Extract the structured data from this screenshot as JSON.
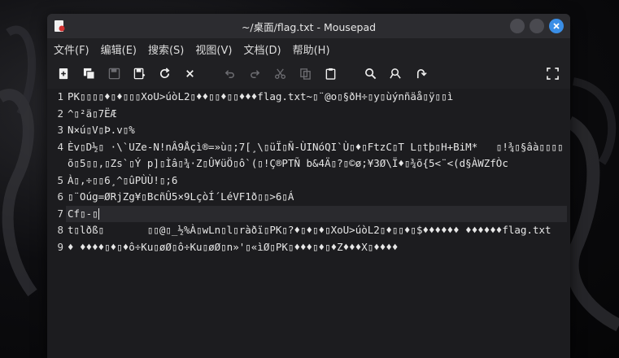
{
  "window": {
    "title": "~/桌面/flag.txt - Mousepad",
    "accent": "#3a8ee6"
  },
  "menu": [
    {
      "label": "文件(F)"
    },
    {
      "label": "编辑(E)"
    },
    {
      "label": "搜索(S)"
    },
    {
      "label": "视图(V)"
    },
    {
      "label": "文档(D)"
    },
    {
      "label": "帮助(H)"
    }
  ],
  "toolbar": {
    "buttons": [
      "new-document-icon",
      "new-window-icon",
      "save-icon",
      "save-as-icon",
      "reload-icon",
      "close-icon",
      "undo-icon",
      "redo-icon",
      "cut-icon",
      "copy-icon",
      "paste-icon",
      "find-icon",
      "find-replace-icon",
      "goto-icon",
      "fullscreen-icon"
    ]
  },
  "editor": {
    "lines": [
      {
        "num": "1",
        "text": "PK▯▯▯▯♦▯♦▯▯▯XoU>úòL2▯♦♦▯▯♦▯▯♦♦♦flag.txt~▯¨@o▯§ðH÷▯y▯ùýnñäå▯ÿ▯▯ì"
      },
      {
        "num": "2",
        "text": "^▯²ä▯7ËÆ"
      },
      {
        "num": "3",
        "text": "N×ú▯V▯Þ.v▯%"
      },
      {
        "num": "4",
        "text": "Èv▯D½▯ ·\\`UZe-N!nÂ9Åçì®=»ù▯;7[¸\\▯üÏ▯Ñ-ÙINóQI`Ù▯♦▯FtzC▯T L▯tþ▯H+BiM*   ▯!¾▯§âà▯▯▯▯õ▯5▯▯,▯Zs`▯Ý p]▯Ìâ▯¾·Z▯Û¥üÖ▯ô`(▯!Ç®PTÑ b&4Ä▯?▯©ø;¥3Ø\\Ï♦▯¾õ{5<¨<(d§ÀWZfÒc"
      },
      {
        "num": "5",
        "text": "À▯,÷▯▯6¸^▯ûPÙÙ!▯;6"
      },
      {
        "num": "6",
        "text": "▯¨Oúg=ØRjZg¥▯BcñÛ5×9LçòÍ´LéVF1ð▯▯>6▯Á"
      },
      {
        "num": "7",
        "text": "Cf▯-▯"
      },
      {
        "num": "8",
        "text": "t▯lðß▯       ▯▯@▯_½%À▯wLn▯l▯ràðï▯PK▯?♦▯♦▯♦▯XoU>úòL2▯♦▯▯♦▯$♦♦♦♦♦♦ ♦♦♦♦♦♦flag.txt"
      },
      {
        "num": "9",
        "text": "♦ ♦♦♦♦▯♦▯♦ô÷Ku▯øØ▯ô÷Ku▯øØ▯n»'▯«ìØ▯PK▯♦♦♦▯♦▯♦Z♦♦♦X▯♦♦♦♦"
      }
    ]
  }
}
